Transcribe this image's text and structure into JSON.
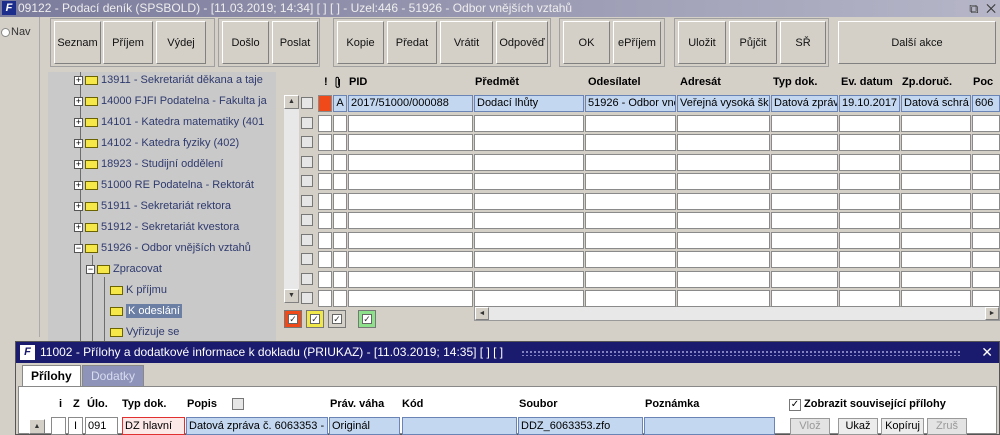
{
  "window": {
    "title": "09122 - Podací deník (SPSBOLD) - [11.03.2019; 14:34]  [ ]  [ ] - Uzel:446 - 51926 - Odbor vnějších vztahů",
    "app_icon": "app-logo-icon",
    "controls": "⧉ ✕"
  },
  "nav": {
    "label": "Nav"
  },
  "toolbar": {
    "buttons": [
      {
        "label": "Seznam"
      },
      {
        "label": "Příjem"
      },
      {
        "label": "Výdej"
      },
      {
        "label": "Došlo"
      },
      {
        "label": "Poslat"
      },
      {
        "label": "Kopie"
      },
      {
        "label": "Předat"
      },
      {
        "label": "Vrátit"
      },
      {
        "label": "Odpověď"
      },
      {
        "label": "OK"
      },
      {
        "label": "ePříjem"
      },
      {
        "label": "Uložit"
      },
      {
        "label": "Půjčit"
      },
      {
        "label": "SŘ"
      },
      {
        "label": "Další akce"
      }
    ]
  },
  "tree": {
    "nodes": [
      {
        "label": "13911 - Sekretariát děkana a taje"
      },
      {
        "label": "14000 FJFI Podatelna - Fakulta ja"
      },
      {
        "label": "14101 - Katedra matematiky (401"
      },
      {
        "label": "14102 - Katedra fyziky (402)"
      },
      {
        "label": "18923 - Studijní oddělení"
      },
      {
        "label": "51000 RE Podatelna - Rektorát"
      },
      {
        "label": "51911 - Sekretariát rektora"
      },
      {
        "label": "51912 - Sekretariát kvestora"
      },
      {
        "label": "51926 - Odbor vnějších vztahů"
      },
      {
        "label": "Zpracovat"
      },
      {
        "label": "K příjmu"
      },
      {
        "label": "K odeslání"
      },
      {
        "label": "Vyřizuje se"
      }
    ]
  },
  "grid": {
    "headers": [
      "!",
      "PID",
      "Předmět",
      "Odesílatel",
      "Adresát",
      "Typ dok.",
      "Ev. datum",
      "Zp.doruč.",
      "Poc"
    ],
    "attachment_icon": "paperclip-icon",
    "row1": {
      "flag": "A",
      "pid": "2017/51000/000088",
      "predmet": "Dodací lhůty",
      "odesilatel": "51926 - Odbor vně",
      "adresat": "Veřejná vysoká šk",
      "typ_dok": "Datová zpráv",
      "ev_datum": "19.10.2017",
      "zp_doruc": "Datová schrá",
      "poc": "606"
    },
    "scroll_up": "▲",
    "scroll_down": "▼",
    "scroll_left": "◄",
    "scroll_right": "►"
  },
  "dialog": {
    "title": "11002 - Přílohy a dodatkové informace k dokladu (PRIUKAZ) - [11.03.2019; 14:35]  [ ]  [ ]",
    "close": "✕",
    "tabs": [
      {
        "label": "Přílohy"
      },
      {
        "label": "Dodatky"
      }
    ],
    "headers": {
      "i": "i",
      "z": "Z",
      "ulo": "Úlo.",
      "typ": "Typ dok.",
      "popis": "Popis",
      "prav": "Práv. váha",
      "kod": "Kód",
      "soubor": "Soubor",
      "poznamka": "Poznámka"
    },
    "show_related": "Zobrazit související přílohy",
    "row": {
      "z": "I",
      "ulo": "091",
      "typ": "DZ hlavní",
      "popis": "Datová zpráva č. 6063353 -",
      "prav": "Originál",
      "kod": "",
      "soubor": "DDZ_6063353.zfo",
      "poznamka": ""
    },
    "buttons": {
      "vloz": "Vlož",
      "ukaz": "Ukaž",
      "kopiruj": "Kopíruj",
      "zrus": "Zruš"
    }
  }
}
